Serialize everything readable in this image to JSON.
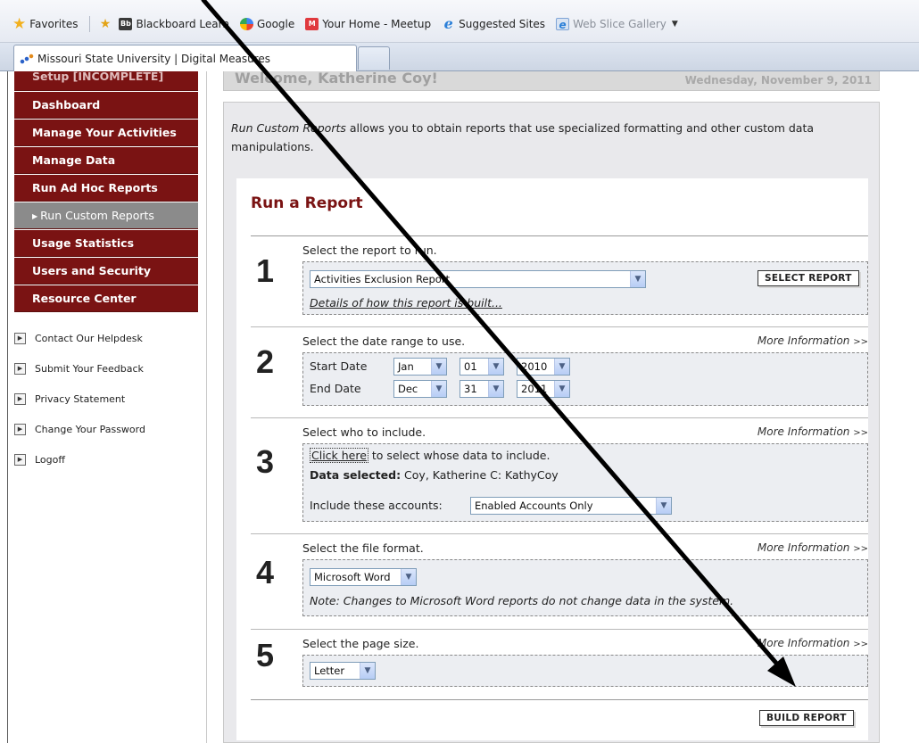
{
  "favorites_bar": {
    "favorites_label": "Favorites",
    "items": [
      {
        "label": "Blackboard Learn"
      },
      {
        "label": "Google"
      },
      {
        "label": "Your Home - Meetup"
      },
      {
        "label": "Suggested Sites"
      },
      {
        "label": "Web Slice Gallery"
      }
    ]
  },
  "tab": {
    "title": "Missouri State University | Digital Measures"
  },
  "sidebar": {
    "items": [
      {
        "label": "Setup [INCOMPLETE]"
      },
      {
        "label": "Dashboard"
      },
      {
        "label": "Manage Your Activities"
      },
      {
        "label": "Manage Data"
      },
      {
        "label": "Run Ad Hoc Reports"
      },
      {
        "label": "Run Custom Reports"
      },
      {
        "label": "Usage Statistics"
      },
      {
        "label": "Users and Security"
      },
      {
        "label": "Resource Center"
      }
    ],
    "links": [
      {
        "label": "Contact Our Helpdesk"
      },
      {
        "label": "Submit Your Feedback"
      },
      {
        "label": "Privacy Statement"
      },
      {
        "label": "Change Your Password"
      },
      {
        "label": "Logoff"
      }
    ]
  },
  "welcome": {
    "title": "Welcome, Katherine Coy!",
    "date": "Wednesday, November 9, 2011"
  },
  "intro": {
    "emph": "Run Custom Reports",
    "rest": " allows you to obtain reports that use specialized formatting and other custom data manipulations."
  },
  "report": {
    "heading": "Run a Report",
    "more_info": "More Information",
    "more_arrows": ">>",
    "steps": [
      {
        "number": "1",
        "label": "Select the report to run.",
        "report_select": "Activities Exclusion Report",
        "select_button": "SELECT REPORT",
        "details_link": "Details of how this report is built..."
      },
      {
        "number": "2",
        "label": "Select the date range to use.",
        "start_label": "Start Date",
        "start_month": "Jan",
        "start_day": "01",
        "start_year": "2010",
        "end_label": "End Date",
        "end_month": "Dec",
        "end_day": "31",
        "end_year": "2011"
      },
      {
        "number": "3",
        "label": "Select who to include.",
        "click_here": "Click here",
        "click_rest": " to select whose data to include.",
        "data_selected_label": "Data selected:",
        "data_selected_value": " Coy, Katherine C: KathyCoy",
        "accounts_label": "Include these accounts:",
        "accounts_select": "Enabled Accounts Only"
      },
      {
        "number": "4",
        "label": "Select the file format.",
        "format_select": "Microsoft Word",
        "note": "Note: Changes to Microsoft Word reports do not change data in the system."
      },
      {
        "number": "5",
        "label": "Select the page size.",
        "size_select": "Letter"
      }
    ],
    "build_button": "BUILD REPORT"
  },
  "colors": {
    "nav_bg": "#7a1313",
    "heading": "#7a1313",
    "active_nav": "#8b8b8b",
    "annotation_arrow": "#000000"
  }
}
